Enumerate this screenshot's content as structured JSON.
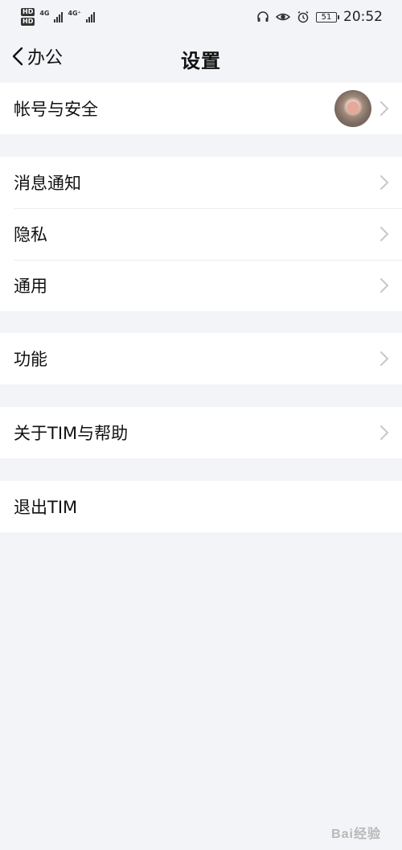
{
  "status_bar": {
    "hd1": "HD",
    "hd2": "HD",
    "net1": "4G",
    "net2": "4G⁺",
    "battery": "51",
    "time": "20:52"
  },
  "nav": {
    "back_label": "办公",
    "title": "设置"
  },
  "groups": [
    {
      "items": [
        {
          "label": "帐号与安全",
          "has_avatar": true,
          "chevron": true
        }
      ]
    },
    {
      "items": [
        {
          "label": "消息通知",
          "chevron": true
        },
        {
          "label": "隐私",
          "chevron": true
        },
        {
          "label": "通用",
          "chevron": true
        }
      ]
    },
    {
      "items": [
        {
          "label": "功能",
          "chevron": true
        }
      ]
    },
    {
      "items": [
        {
          "label": "关于TIM与帮助",
          "chevron": true
        }
      ]
    },
    {
      "items": [
        {
          "label": "退出TIM",
          "chevron": false
        }
      ]
    }
  ],
  "watermark": "Bai经验",
  "colors": {
    "background": "#f3f4f7",
    "row": "#ffffff",
    "chevron": "#c7c7cc",
    "text": "#111111"
  }
}
